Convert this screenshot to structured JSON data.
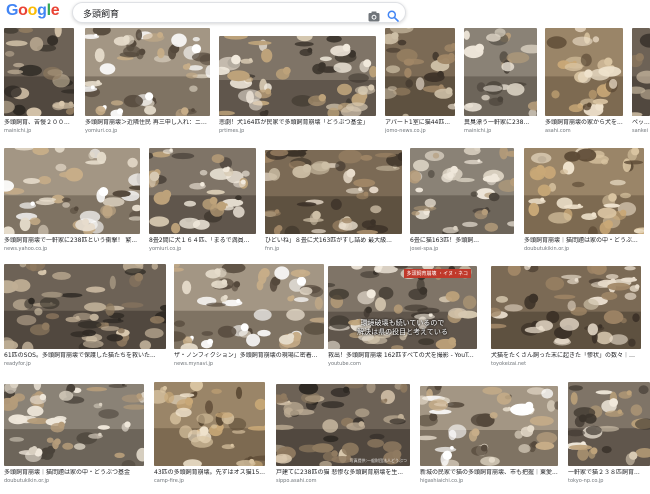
{
  "brand": {
    "logo_letters": [
      "G",
      "o",
      "o",
      "g",
      "l",
      "e"
    ],
    "logo_colors": [
      "#4285f4",
      "#ea4335",
      "#fbbc05",
      "#4285f4",
      "#34a853",
      "#ea4335"
    ]
  },
  "search": {
    "query": "多頭飼育",
    "camera_icon": "camera-icon",
    "search_icon": "search-icon",
    "accent": "#4285f4"
  },
  "results": [
    {
      "caption": "多頭飼育、苦慢２００...",
      "source": "mainichi.jp"
    },
    {
      "caption": "多頭飼育崩壊＞近隣住民 再三申し入れ：ニュ...",
      "source": "yomiuri.co.jp"
    },
    {
      "caption": "悲劇！犬164匹が民家で多頭飼育崩壊「どうぶつ基金」",
      "source": "prtimes.jp"
    },
    {
      "caption": "アパート1室に猫44匹...",
      "source": "jomo-news.co.jp"
    },
    {
      "caption": "異臭漂う一軒家に238...",
      "source": "mainichi.jp"
    },
    {
      "caption": "多頭飼育崩壊の家から犬を...",
      "source": "asahi.com"
    },
    {
      "caption": "ペッ...",
      "source": "sankei"
    },
    {
      "caption": "多頭飼育崩壊で一軒家に238匹という衝撃！ 繁...",
      "source": "news.yahoo.co.jp"
    },
    {
      "caption": "8畳2間に犬１６４匹、「まるで満員...",
      "source": "yomiuri.co.jp"
    },
    {
      "caption": "ひどいね」８畳に犬163匹がすし詰め 最大級...",
      "source": "fnn.jp"
    },
    {
      "caption": "6畳に猫163匹！多頭飼...",
      "source": "josei-spa.jp"
    },
    {
      "caption": "多頭飼育崩壊｜猫問題は家の中・どうぶ...",
      "source": "doubutukikin.or.jp"
    },
    {
      "caption": "61匹のSOS。多頭飼育崩壊で保護した猫たちを救いた...",
      "source": "readyfor.jp"
    },
    {
      "caption": "ザ・ノンフィクション」多頭飼育崩壊の現場に密着...",
      "source": "news.mynavi.jp"
    },
    {
      "caption": "救出！多頭飼育崩壊 162匹すべての犬を撮影 - YouTube",
      "source": "youtube.com"
    },
    {
      "caption": "犬猫をたくさん飼った末に起きた「惨状」の数々｜ペット...",
      "source": "toyokeizai.net"
    },
    {
      "caption": "多頭飼育崩壊｜猫問題は家の中・どうぶつ基金",
      "source": "doubutukikin.or.jp"
    },
    {
      "caption": "43匹の多頭飼育崩壊。先ずはオス猫15...",
      "source": "camp-fire.jp"
    },
    {
      "caption": "戸建てに238匹の猫 悲惨な多頭飼育崩壊を生...",
      "source": "sippo.asahi.com"
    },
    {
      "caption": "新城の民家で猫の多頭飼育崩壊、市も把握｜東愛...",
      "source": "higashiaichi.co.jp"
    },
    {
      "caption": "一軒家で猫２３８匹飼育...",
      "source": "tokyo-np.co.jp"
    }
  ],
  "overlay": {
    "youtube_top_tag": "多頭飼育崩壊 ・イヌ・ネコ",
    "youtube_subtitle_line1": "環境破壊も続いているので",
    "youtube_subtitle_line2": "解決は県の役目と考えている",
    "sippo_watermark": "写真提供:一般財団法人どうぶつ"
  }
}
